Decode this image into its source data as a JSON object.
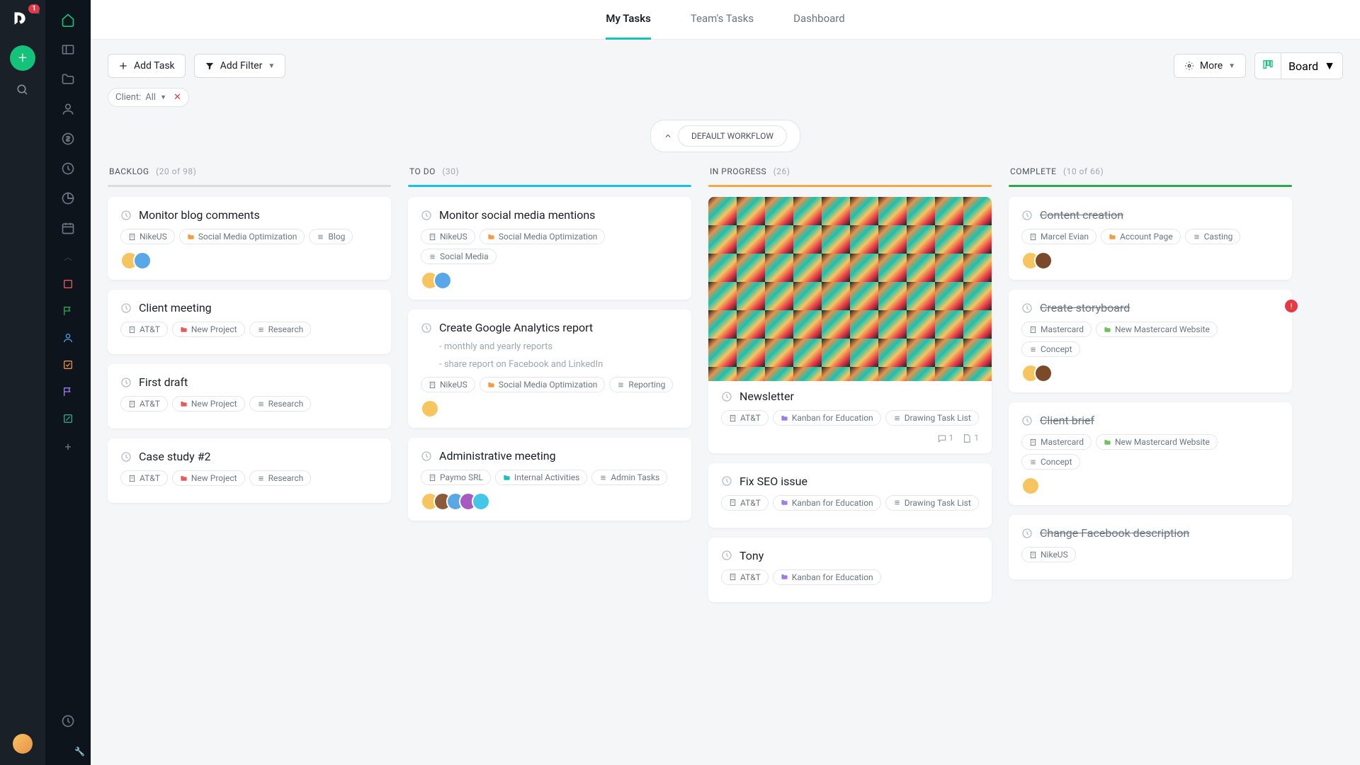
{
  "nav_rail": {
    "badge_count": "1"
  },
  "tabs": [
    {
      "label": "My Tasks",
      "active": true
    },
    {
      "label": "Team's Tasks",
      "active": false
    },
    {
      "label": "Dashboard",
      "active": false
    }
  ],
  "toolbar": {
    "add_task": "Add Task",
    "add_filter": "Add Filter",
    "more": "More",
    "board": "Board"
  },
  "filter_chip": {
    "label": "Client:",
    "value": "All"
  },
  "workflow": "DEFAULT WORKFLOW",
  "columns": [
    {
      "title": "BACKLOG",
      "count": "(20 of 98)",
      "bar_color": "#d8dce1",
      "cards": [
        {
          "title": "Monitor blog comments",
          "tags": [
            {
              "icon": "building",
              "text": "NikeUS"
            },
            {
              "icon": "folder",
              "color": "orange",
              "text": "Social Media Optimization"
            },
            {
              "icon": "list",
              "text": "Blog"
            }
          ],
          "avatars": [
            "#f6c560",
            "#5aa7e8"
          ]
        },
        {
          "title": "Client meeting",
          "tags": [
            {
              "icon": "building",
              "text": "AT&T"
            },
            {
              "icon": "folder",
              "color": "red",
              "text": "New Project"
            },
            {
              "icon": "list",
              "text": "Research"
            }
          ]
        },
        {
          "title": "First draft",
          "tags": [
            {
              "icon": "building",
              "text": "AT&T"
            },
            {
              "icon": "folder",
              "color": "red",
              "text": "New Project"
            },
            {
              "icon": "list",
              "text": "Research"
            }
          ]
        },
        {
          "title": "Case study #2",
          "tags": [
            {
              "icon": "building",
              "text": "AT&T"
            },
            {
              "icon": "folder",
              "color": "red",
              "text": "New Project"
            },
            {
              "icon": "list",
              "text": "Research"
            }
          ]
        }
      ]
    },
    {
      "title": "TO DO",
      "count": "(30)",
      "bar_color": "#15c2e8",
      "cards": [
        {
          "title": "Monitor social media mentions",
          "tags": [
            {
              "icon": "building",
              "text": "NikeUS"
            },
            {
              "icon": "folder",
              "color": "orange",
              "text": "Social Media Optimization"
            },
            {
              "icon": "list",
              "text": "Social Media"
            }
          ],
          "avatars": [
            "#f6c560",
            "#5aa7e8"
          ]
        },
        {
          "title": "Create Google Analytics report",
          "subs": [
            "- monthly and yearly reports",
            "- share report on Facebook and LinkedIn"
          ],
          "tags": [
            {
              "icon": "building",
              "text": "NikeUS"
            },
            {
              "icon": "folder",
              "color": "orange",
              "text": "Social Media Optimization"
            },
            {
              "icon": "list",
              "text": "Reporting"
            }
          ],
          "avatars": [
            "#f6c560"
          ]
        },
        {
          "title": "Administrative meeting",
          "tags": [
            {
              "icon": "building",
              "text": "Paymo SRL"
            },
            {
              "icon": "folder",
              "color": "teal",
              "text": "Internal Activities"
            },
            {
              "icon": "list",
              "text": "Admin Tasks"
            }
          ],
          "avatars": [
            "#f6c560",
            "#8a5a3a",
            "#5aa7e8",
            "#a75ac2",
            "#42c7e8"
          ]
        }
      ]
    },
    {
      "title": "IN PROGRESS",
      "count": "(26)",
      "bar_color": "#f5a742",
      "cards": [
        {
          "image": true,
          "title": "Newsletter",
          "tags": [
            {
              "icon": "building",
              "text": "AT&T"
            },
            {
              "icon": "folder",
              "color": "purple",
              "text": "Kanban for Education"
            },
            {
              "icon": "list",
              "text": "Drawing Task List"
            }
          ],
          "meta": {
            "comments": "1",
            "files": "1"
          }
        },
        {
          "title": "Fix SEO issue",
          "tags": [
            {
              "icon": "building",
              "text": "AT&T"
            },
            {
              "icon": "folder",
              "color": "purple",
              "text": "Kanban for Education"
            },
            {
              "icon": "list",
              "text": "Drawing Task List"
            }
          ]
        },
        {
          "title": "Tony",
          "tags": [
            {
              "icon": "building",
              "text": "AT&T"
            },
            {
              "icon": "folder",
              "color": "purple",
              "text": "Kanban for Education"
            }
          ]
        }
      ]
    },
    {
      "title": "COMPLETE",
      "count": "(10 of 66)",
      "bar_color": "#2ea44f",
      "cards": [
        {
          "title": "Content creation",
          "done": true,
          "tags": [
            {
              "icon": "building",
              "text": "Marcel Evian"
            },
            {
              "icon": "folder",
              "color": "orange",
              "text": "Account Page"
            },
            {
              "icon": "list",
              "text": "Casting"
            }
          ],
          "avatars": [
            "#f6c560",
            "#7a4a2a"
          ]
        },
        {
          "title": "Create storyboard",
          "done": true,
          "alert": true,
          "tags": [
            {
              "icon": "building",
              "text": "Mastercard"
            },
            {
              "icon": "folder",
              "color": "green",
              "text": "New Mastercard Website"
            },
            {
              "icon": "list",
              "text": "Concept"
            }
          ],
          "avatars": [
            "#f6c560",
            "#7a4a2a"
          ]
        },
        {
          "title": "Client brief",
          "done": true,
          "tags": [
            {
              "icon": "building",
              "text": "Mastercard"
            },
            {
              "icon": "folder",
              "color": "green",
              "text": "New Mastercard Website"
            },
            {
              "icon": "list",
              "text": "Concept"
            }
          ],
          "avatars": [
            "#f6c560"
          ]
        },
        {
          "title": "Change Facebook description",
          "done": true,
          "tags": [
            {
              "icon": "building",
              "text": "NikeUS"
            }
          ]
        }
      ]
    }
  ]
}
